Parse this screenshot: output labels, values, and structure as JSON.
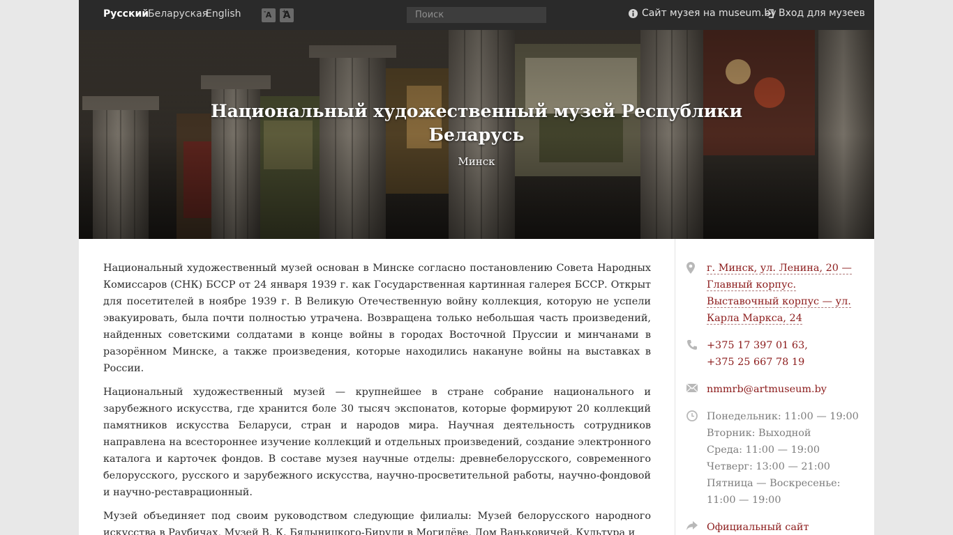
{
  "topbar": {
    "languages": [
      {
        "label": "Русский",
        "active": true
      },
      {
        "label": "Беларуская",
        "active": false
      },
      {
        "label": "English",
        "active": false
      }
    ],
    "font_decrease_label": "A",
    "font_increase_label": "A",
    "search_placeholder": "Поиск",
    "museum_site_link": "Сайт музея на museum.by",
    "login_link": "Вход для музеев"
  },
  "hero": {
    "title": "Национальный художественный музей Республики Беларусь",
    "subtitle": "Минск"
  },
  "main": {
    "paragraphs": [
      "Национальный художественный музей основан в Минске согласно постановлению Совета Народных Комиссаров (СНК) БССР от 24 января 1939 г. как Государственная картинная галерея БССР. Открыт для посетителей в ноябре 1939 г. В Великую Отечественную войну коллекция, которую не успели эвакуировать, была почти полностью утрачена. Возвращена только небольшая часть произведений, найденных советскими солдатами в конце войны в городах Восточной Пруссии и минчанами в разорённом Минске, а также произведения, которые находились накануне войны на выставках в России.",
      "Национальный художественный музей — крупнейшее в стране собрание национального и зарубежного искусства, где хранится боле 30 тысяч экспонатов, которые формируют 20 коллекций памятников искусства Беларуси, стран и народов мира. Научная деятельность сотрудников направлена на всестороннее изучение коллекций и отдельных произведений, создание электронного каталога и карточек фондов. В составе музея научные отделы: древнебелорусского, современного белорусского, русского и зарубежного искусства, научно-просветительной работы, научно-фондовой и научно-реставрационный.",
      "Музей объединяет под своим руководством следующие филиалы: Музей белорусского народного искусства в Раубичах, Музей В. К. Бялыницкого-Бирули в Могилёве, Дом Ваньковичей. Культура и"
    ]
  },
  "sidebar": {
    "address_lines": [
      "г. Минск, ул. Ленина, 20 —",
      "Главный корпус.",
      "Выставочный корпус — ул.",
      "Карла Маркса, 24"
    ],
    "phone_lines": [
      "+375 17 397 01 63,",
      "+375 25 667 78 19"
    ],
    "email": "nmmrb@artmuseum.by",
    "hours": [
      "Понедельник: 11:00 — 19:00",
      "Вторник: Выходной",
      "Среда: 11:00 — 19:00",
      "Четверг: 13:00 — 21:00",
      "Пятница — Воскресенье:",
      "11:00 — 19:00"
    ],
    "official_site": "Официальный сайт"
  },
  "colors": {
    "accent": "#8b1a1a",
    "topbar": "#2a2a2a",
    "page_bg": "#e8e8e8"
  }
}
